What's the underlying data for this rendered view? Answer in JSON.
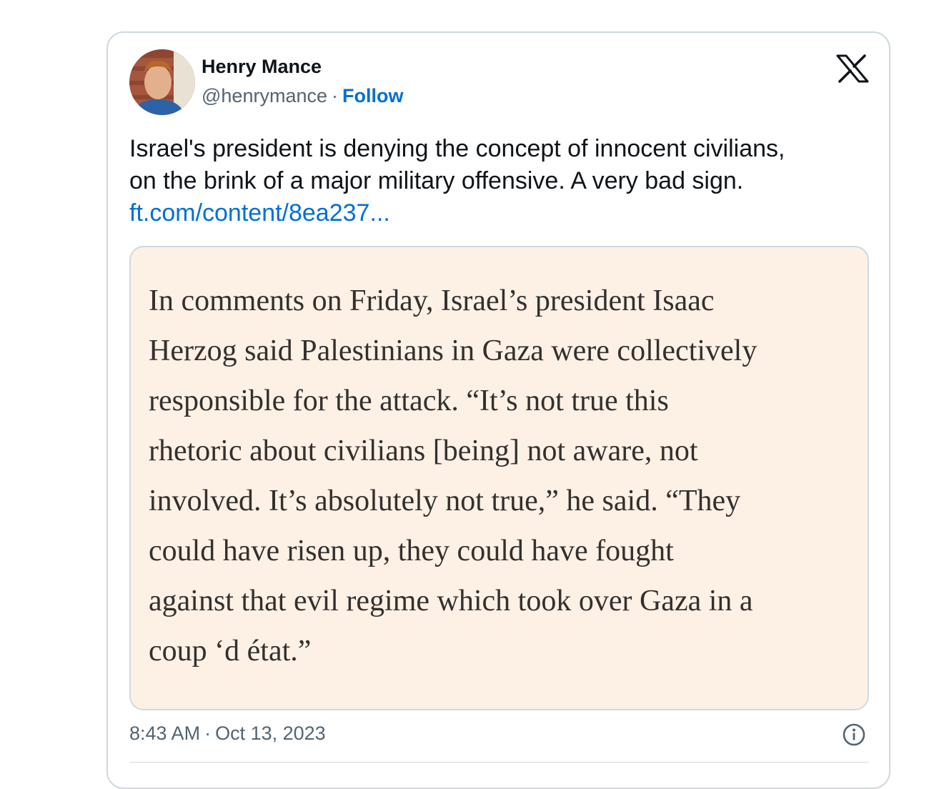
{
  "author": {
    "name": "Henry Mance",
    "handle": "@henrymance",
    "separator": "·",
    "follow_label": "Follow"
  },
  "platform_icon": "x-logo-icon",
  "tweet": {
    "text_lines": [
      "Israel's president is denying the concept of innocent civilians,",
      "on the brink of a major military offensive. A very bad sign."
    ],
    "link": "ft.com/content/8ea237..."
  },
  "quote_image": {
    "lines": [
      "In comments on Friday, Israel’s president Isaac",
      "Herzog said Palestinians in Gaza were collectively",
      "responsible for the attack. “It’s not true this",
      "rhetoric about civilians [being] not aware, not",
      "involved. It’s absolutely not true,” he said. “They",
      "could have risen up, they could have fought",
      "against that evil regime which took over Gaza in a",
      "coup ‘d état.”"
    ],
    "background": "#fdf1e6"
  },
  "footer": {
    "time": "8:43 AM",
    "separator": "·",
    "date": "Oct 13, 2023",
    "info_icon": "info-icon"
  },
  "colors": {
    "link_blue": "#006fd6",
    "text_primary": "#0f1419",
    "text_secondary": "#536471",
    "border": "#cfd9de"
  }
}
